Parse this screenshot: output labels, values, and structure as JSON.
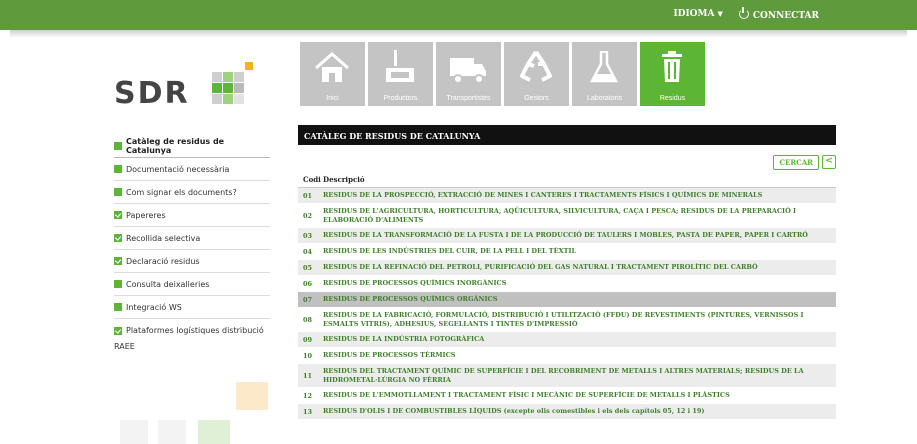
{
  "topbar": {
    "idioma_label": "IDIOMA",
    "connectar_label": "CONNECTAR"
  },
  "logo": {
    "text": "SDR"
  },
  "nav_tiles": [
    {
      "label": "Inici",
      "icon": "house-icon"
    },
    {
      "label": "Productors",
      "icon": "factory-icon"
    },
    {
      "label": "Transportistes",
      "icon": "truck-icon"
    },
    {
      "label": "Gestors",
      "icon": "recycle-icon"
    },
    {
      "label": "Laboratoris",
      "icon": "flask-icon"
    },
    {
      "label": "Residus",
      "icon": "trash-icon",
      "active": true
    }
  ],
  "sidebar": {
    "items": [
      {
        "label": "Catàleg de residus de Catalunya",
        "marker": "square"
      },
      {
        "label": "Documentació necessària",
        "marker": "square"
      },
      {
        "label": "Com signar els documents?",
        "marker": "square"
      },
      {
        "label": "Papereres",
        "marker": "check"
      },
      {
        "label": "Recollida selectiva",
        "marker": "check"
      },
      {
        "label": "Declaració residus",
        "marker": "check"
      },
      {
        "label": "Consulta deixalleries",
        "marker": "square"
      },
      {
        "label": "Integració WS",
        "marker": "square"
      },
      {
        "label": "Plataformes logístiques distribució",
        "label2": "RAEE",
        "marker": "check"
      }
    ]
  },
  "catalog": {
    "title": "CATÀLEG DE RESIDUS DE CATALUNYA",
    "search_button": "CERCAR",
    "back_button": "<",
    "columns": {
      "code": "Codi",
      "description": "Descripció"
    },
    "rows": [
      {
        "code": "01",
        "desc": "RESIDUS DE LA PROSPECCIÓ, EXTRACCIÓ DE MINES I CANTERES I TRACTAMENTS FÍSICS I QUÍMICS DE MINERALS"
      },
      {
        "code": "02",
        "desc": "RESIDUS DE L'AGRICULTURA, HORTICULTURA, AQÜICULTURA, SILVICULTURA, CAÇA I PESCA; RESIDUS DE LA PREPARACIÓ I ELABORACIÓ D'ALIMENTS"
      },
      {
        "code": "03",
        "desc": "RESIDUS DE LA TRANSFORMACIÓ DE LA FUSTA I DE LA PRODUCCIÓ DE TAULERS I MOBLES, PASTA DE PAPER, PAPER I CARTRÓ"
      },
      {
        "code": "04",
        "desc": "RESIDUS DE LES INDÚSTRIES DEL CUIR, DE LA PELL I DEL TÈXTIL"
      },
      {
        "code": "05",
        "desc": "RESIDUS DE LA REFINACIÓ DEL PETROLI, PURIFICACIÓ DEL GAS NATURAL I TRACTAMENT PIROLÍTIC DEL CARBÓ"
      },
      {
        "code": "06",
        "desc": "RESIDUS DE PROCESSOS QUÍMICS INORGÀNICS"
      },
      {
        "code": "07",
        "desc": "RESIDUS DE PROCESSOS QUÍMICS ORGÀNICS"
      },
      {
        "code": "08",
        "desc": "RESIDUS DE LA FABRICACIÓ, FORMULACIÓ, DISTRIBUCIÓ I UTILITZACIÓ (FFDU) DE REVESTIMENTS (PINTURES, VERNISSOS I ESMALTS VITRIS), ADHESIUS, SEGELLANTS I TINTES D'IMPRESSIÓ"
      },
      {
        "code": "09",
        "desc": "RESIDUS DE LA INDÚSTRIA FOTOGRÀFICA"
      },
      {
        "code": "10",
        "desc": "RESIDUS DE PROCESSOS TÈRMICS"
      },
      {
        "code": "11",
        "desc": "RESIDUS DEL TRACTAMENT QUÍMIC DE SUPERFÍCIE I DEL RECOBRIMENT DE METALLS I ALTRES MATERIALS; RESIDUS DE LA HIDROMETAL·LÚRGIA NO FÈRRIA"
      },
      {
        "code": "12",
        "desc": "RESIDUS DE L'EMMOTLLAMENT I TRACTAMENT FÍSIC I MECÀNIC DE SUPERFÍCIE DE METALLS I PLÀSTICS"
      },
      {
        "code": "13",
        "desc": "RESIDUS D'OLIS I DE COMBUSTIBLES LÍQUIDS (excepte olis comestibles i els dels capítols 05, 12 i 19)"
      }
    ]
  },
  "colors": {
    "brand_green": "#5cb534",
    "topbar_green": "#5f9a3c",
    "link_green": "#3e7f2a"
  }
}
